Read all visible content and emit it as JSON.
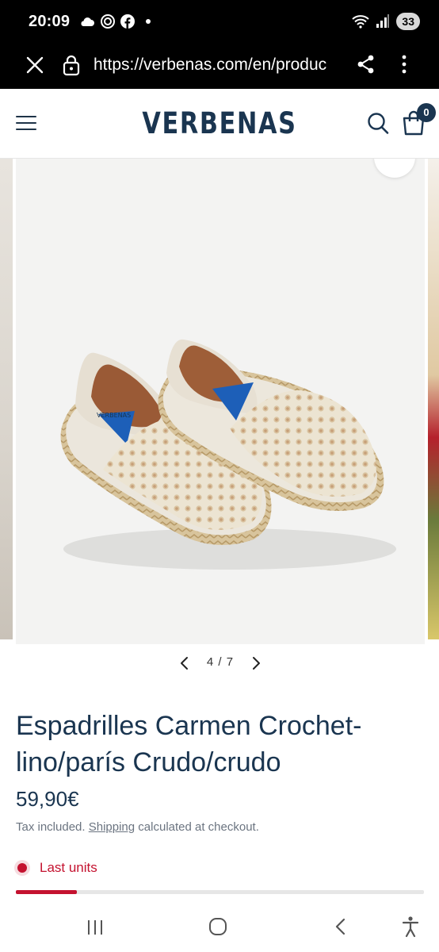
{
  "status_bar": {
    "time": "20:09",
    "icons_left": [
      "cloud-icon",
      "data-saver-icon",
      "facebook-icon"
    ],
    "icons_right": [
      "wifi-icon",
      "signal-icon"
    ],
    "battery": "33"
  },
  "browser": {
    "url": "https://verbenas.com/en/produc",
    "close_icon": "close-icon",
    "lock_icon": "lock-icon",
    "share_icon": "share-icon",
    "menu_icon": "more-vert-icon"
  },
  "header": {
    "logo": "VERBENAS",
    "cart_count": "0",
    "brand_color": "#1a3550"
  },
  "gallery": {
    "current": "4",
    "separator": "/",
    "total": "7",
    "shoe_tag": "VERBENAS"
  },
  "product": {
    "title": "Espadrilles Carmen Crochet-lino/parís Crudo/crudo",
    "price": "59,90€",
    "tax_prefix": "Tax included.",
    "shipping_link": "Shipping",
    "tax_suffix": "calculated at checkout.",
    "stock_label": "Last units",
    "stock_level": 0.15,
    "stock_color": "#c4122f"
  },
  "nav_bar": {
    "icons": [
      "recents-icon",
      "home-icon",
      "back-icon",
      "accessibility-icon"
    ]
  }
}
